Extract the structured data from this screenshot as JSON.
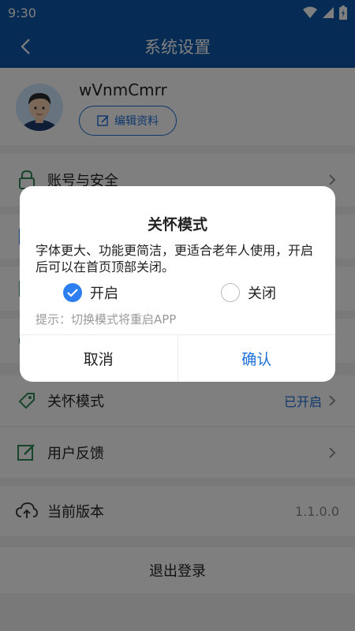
{
  "status_bar": {
    "time": "9:30"
  },
  "app_bar": {
    "title": "系统设置"
  },
  "profile": {
    "username": "wVnmCmrr",
    "edit_label": "编辑资料"
  },
  "settings": {
    "account_security": "账号与安全",
    "care_mode": {
      "label": "关怀模式",
      "value": "已开启"
    },
    "feedback": "用户反馈",
    "version": {
      "label": "当前版本",
      "value": "1.1.0.0"
    }
  },
  "logout_label": "退出登录",
  "dialog": {
    "title": "关怀模式",
    "description": "字体更大、功能更简洁，更适合老年人使用，开启后可以在首页顶部关闭。",
    "option_on": "开启",
    "option_off": "关闭",
    "selected": "on",
    "hint": "提示：切换模式将重启APP",
    "cancel": "取消",
    "confirm": "确认"
  },
  "colors": {
    "brand": "#0d57a8",
    "accent": "#1e6fd9",
    "radio_checked": "#2d7ef0"
  },
  "icons": [
    "wifi-icon",
    "signal-icon",
    "battery-icon",
    "back-arrow-icon",
    "edit-icon",
    "lock-icon",
    "care-mode-icon",
    "feedback-icon",
    "cloud-upload-icon",
    "chevron-right-icon",
    "check-icon"
  ]
}
